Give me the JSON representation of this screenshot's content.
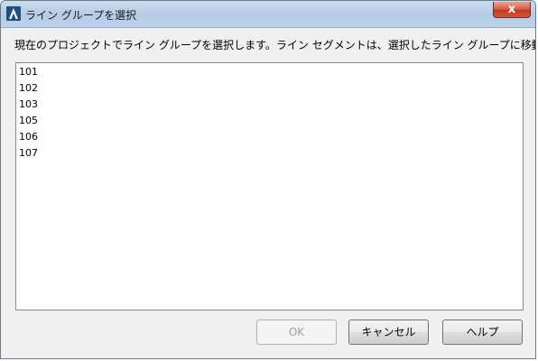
{
  "window": {
    "title": "ライン グループを選択",
    "close_label": "x"
  },
  "instruction": "現在のプロジェクトでライン グループを選択します。ライン セグメントは、選択したライン グループに移動されます。",
  "line_groups": [
    "101",
    "102",
    "103",
    "105",
    "106",
    "107"
  ],
  "buttons": {
    "ok": "OK",
    "ok_enabled": false,
    "cancel": "キャンセル",
    "help": "ヘルプ"
  },
  "colors": {
    "titlebar": "#b5cce6",
    "close_button": "#c23b22",
    "background": "#f0f0f0"
  },
  "icons": {
    "app": "autocad-civil-icon"
  }
}
